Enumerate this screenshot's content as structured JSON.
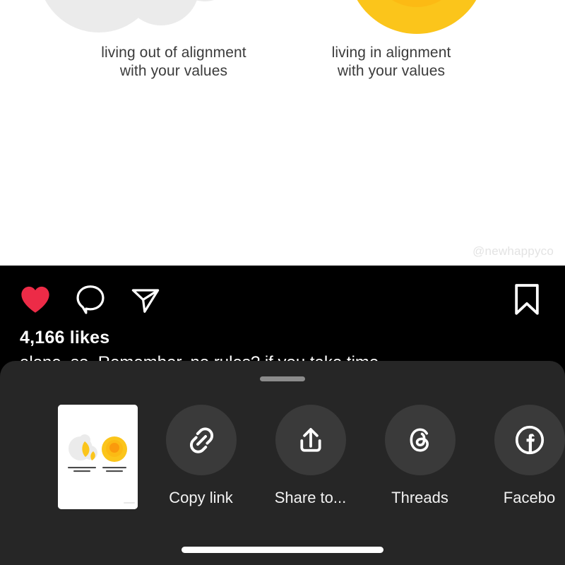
{
  "post": {
    "media": {
      "left_panel": {
        "label": "living out of alignment\nwith your values",
        "label_line1": "living out of alignment",
        "label_line2": "with your values",
        "icon": "scattered-blobs-graphic",
        "colors": {
          "blob_gray": "#ebebeb",
          "accent_yellow": "#fbc51b"
        }
      },
      "right_panel": {
        "label": "living in alignment\nwith your values",
        "label_line1": "living in alignment",
        "label_line2": "with your values",
        "icon": "concentric-circles-graphic",
        "colors": {
          "outer_yellow": "#fbc51b",
          "mid_yellow": "#fcb813",
          "core_orange": "#fb9a0c"
        }
      },
      "watermark": "@newhappyco",
      "background": "#ffffff"
    },
    "actions": {
      "like": {
        "icon": "heart-icon",
        "state": "liked",
        "color": "#ed2b47"
      },
      "comment": {
        "icon": "comment-icon"
      },
      "share": {
        "icon": "paper-plane-icon"
      },
      "bookmark": {
        "icon": "bookmark-icon"
      }
    },
    "likes_text": "4,166 likes",
    "caption": "alone, so. Remember, no rules? if you take time"
  },
  "share_sheet": {
    "grabber": "sheet-grabber-handle",
    "thumbnail": {
      "name": "post-thumbnail-preview",
      "left_label_line1": "living out of alignment",
      "left_label_line2": "with your values",
      "right_label_line1": "living in alignment",
      "right_label_line2": "with your values",
      "watermark": "@newhappyco"
    },
    "targets": [
      {
        "label": "Copy link",
        "icon": "link-icon"
      },
      {
        "label": "Share to...",
        "icon": "share-upload-icon"
      },
      {
        "label": "Threads",
        "icon": "threads-icon"
      },
      {
        "label": "Facebo",
        "icon": "facebook-icon"
      }
    ],
    "home_indicator": "home-indicator-bar",
    "colors": {
      "sheet_bg": "#262626",
      "circle_bg": "#3a3a3a",
      "label": "#f2f2f2"
    }
  }
}
